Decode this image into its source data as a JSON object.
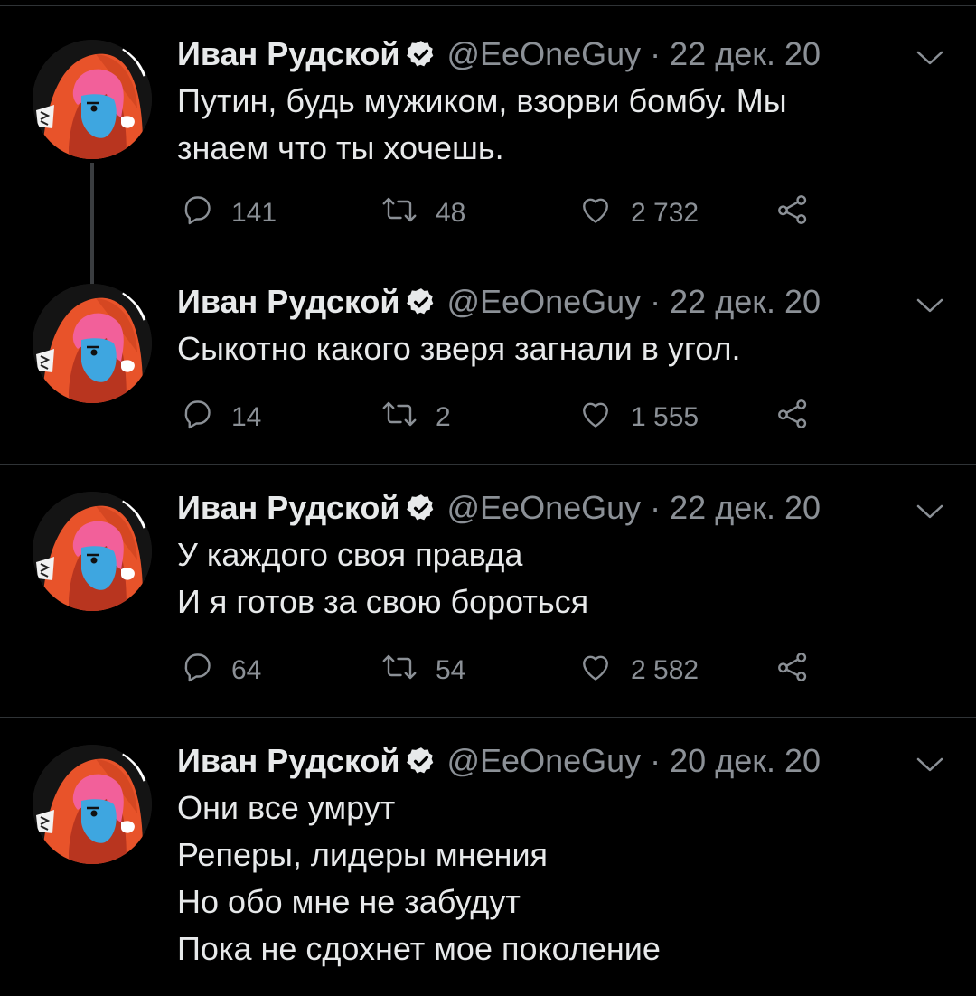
{
  "tweets": [
    {
      "author": "Иван Рудской",
      "handle": "@EeOneGuy",
      "dot": "·",
      "date": "22 дек. 20",
      "text_lines": [
        "Путин, будь мужиком, взорви бомбу. Мы",
        "знаем что ты хочешь."
      ],
      "replies": "141",
      "retweets": "48",
      "likes": "2 732"
    },
    {
      "author": "Иван Рудской",
      "handle": "@EeOneGuy",
      "dot": "·",
      "date": "22 дек. 20",
      "text_lines": [
        "Сыкотно какого зверя загнали в угол."
      ],
      "replies": "14",
      "retweets": "2",
      "likes": "1 555"
    },
    {
      "author": "Иван Рудской",
      "handle": "@EeOneGuy",
      "dot": "·",
      "date": "22 дек. 20",
      "text_lines": [
        "У каждого своя правда",
        "И я готов за свою бороться"
      ],
      "replies": "64",
      "retweets": "54",
      "likes": "2 582"
    },
    {
      "author": "Иван Рудской",
      "handle": "@EeOneGuy",
      "dot": "·",
      "date": "20 дек. 20",
      "text_lines": [
        "Они все умрут",
        "Реперы, лидеры мнения",
        "Но обо мне не забудут",
        "Пока не сдохнет мое поколение"
      ],
      "replies": "",
      "retweets": "",
      "likes": ""
    }
  ],
  "icons": {
    "verified": "verified-badge-icon",
    "caret": "chevron-down-icon",
    "reply": "reply-bubble-icon",
    "retweet": "retweet-icon",
    "like": "heart-icon",
    "share": "share-icon"
  },
  "colors": {
    "background": "#000000",
    "text": "#e7e9ea",
    "secondary": "#8b9096",
    "divider": "#2f3336",
    "verified_badge": "#e7e9ea",
    "avatar_hood": "#e8532a",
    "avatar_skin": "#3ea6e0",
    "avatar_hair": "#f2609a"
  }
}
